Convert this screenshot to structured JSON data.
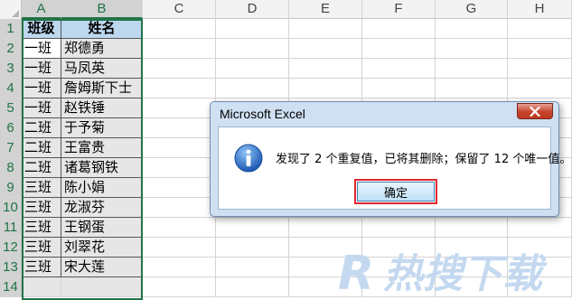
{
  "spreadsheet": {
    "columns": [
      "A",
      "B",
      "C",
      "D",
      "E",
      "F",
      "G",
      "H"
    ],
    "rows": [
      "1",
      "2",
      "3",
      "4",
      "5",
      "6",
      "7",
      "8",
      "9",
      "10",
      "11",
      "12",
      "13",
      "14"
    ],
    "header": {
      "class": "班级",
      "name": "姓名"
    },
    "data": [
      {
        "class": "一班",
        "name": "郑德勇"
      },
      {
        "class": "一班",
        "name": "马凤英"
      },
      {
        "class": "一班",
        "name": "詹姆斯下士"
      },
      {
        "class": "一班",
        "name": "赵铁锤"
      },
      {
        "class": "二班",
        "name": "于予菊"
      },
      {
        "class": "二班",
        "name": "王富贵"
      },
      {
        "class": "二班",
        "name": "诸葛钢铁"
      },
      {
        "class": "三班",
        "name": "陈小娟"
      },
      {
        "class": "三班",
        "name": "龙淑芬"
      },
      {
        "class": "三班",
        "name": "王钢蛋"
      },
      {
        "class": "三班",
        "name": "刘翠花"
      },
      {
        "class": "三班",
        "name": "宋大莲"
      }
    ],
    "header_fill_color": "#bdd7ee",
    "selection_color": "#217346"
  },
  "dialog": {
    "title": "Microsoft Excel",
    "icon": "info-icon",
    "message": "发现了 2 个重复值，已将其删除；保留了 12 个唯一值。",
    "ok_label": "确定",
    "highlight_color": "#e3262e"
  },
  "watermark": {
    "brand": "R",
    "text": "热搜下载"
  }
}
